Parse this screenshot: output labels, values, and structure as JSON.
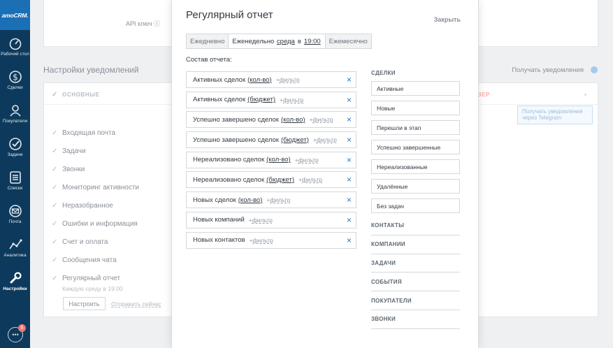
{
  "sidebar": {
    "logo": "amoCRM.",
    "items": [
      {
        "label": "Рабочий стол",
        "icon": "dashboard-icon"
      },
      {
        "label": "Сделки",
        "icon": "dollar-icon"
      },
      {
        "label": "Покупатели",
        "icon": "customers-icon"
      },
      {
        "label": "Задачи",
        "icon": "check-icon"
      },
      {
        "label": "Списки",
        "icon": "list-icon"
      },
      {
        "label": "Почта",
        "icon": "mail-icon"
      },
      {
        "label": "Аналитика",
        "icon": "analytics-icon"
      },
      {
        "label": "Настройки",
        "icon": "wrench-icon"
      }
    ],
    "chat_badge": "6"
  },
  "background": {
    "api_label": "API ключ",
    "section_title": "Настройки уведомлений",
    "receive_notifications": "Получать уведомления",
    "header_label": "ОСНОВНЫЕ",
    "red_fragment": "ВЕР",
    "telegram_hint": "Получать уведомления через Telegram",
    "rows": [
      "Входящая почта",
      "Задачи",
      "Звонки",
      "Мониторинг активности",
      "Неразобранное",
      "Ошибки и информация",
      "Счет и оплата",
      "Сообщения чата",
      "Регулярный отчет"
    ],
    "regular_sub": "Каждую среду в 19:00",
    "setup_button": "Настроить",
    "send_now": "Отправить сейчас"
  },
  "modal": {
    "title": "Регулярный отчет",
    "close": "Закрыть",
    "freq": {
      "daily": "Ежедневно",
      "weekly_prefix": "Еженедельно",
      "weekly_day": "среда",
      "weekly_in": "в",
      "weekly_time": "19:00",
      "monthly": "Ежемесячно"
    },
    "composition_label": "Состав отчета:",
    "filter_label": "фильтр",
    "report_items": [
      {
        "text": "Активных сделок",
        "link": "(кол-во)"
      },
      {
        "text": "Активных сделок",
        "link": "(бюджет)"
      },
      {
        "text": "Успешно завершено сделок",
        "link": "(кол-во)"
      },
      {
        "text": "Успешно завершено сделок",
        "link": "(бюджет)"
      },
      {
        "text": "Нереализовано сделок",
        "link": "(кол-во)"
      },
      {
        "text": "Нереализовано сделок",
        "link": "(бюджет)"
      },
      {
        "text": "Новых сделок",
        "link": "(кол-во)"
      },
      {
        "text": "Новых компаний",
        "link": ""
      },
      {
        "text": "Новых контактов",
        "link": ""
      }
    ],
    "deals_title": "СДЕЛКИ",
    "deal_chips": [
      "Активные",
      "Новые",
      "Перешли в этап",
      "Успешно завершенные",
      "Нереализованные",
      "Удалённые",
      "Без задач"
    ],
    "categories": [
      "КОНТАКТЫ",
      "КОМПАНИИ",
      "ЗАДАЧИ",
      "СОБЫТИЯ",
      "ПОКУПАТЕЛИ",
      "ЗВОНКИ"
    ]
  }
}
